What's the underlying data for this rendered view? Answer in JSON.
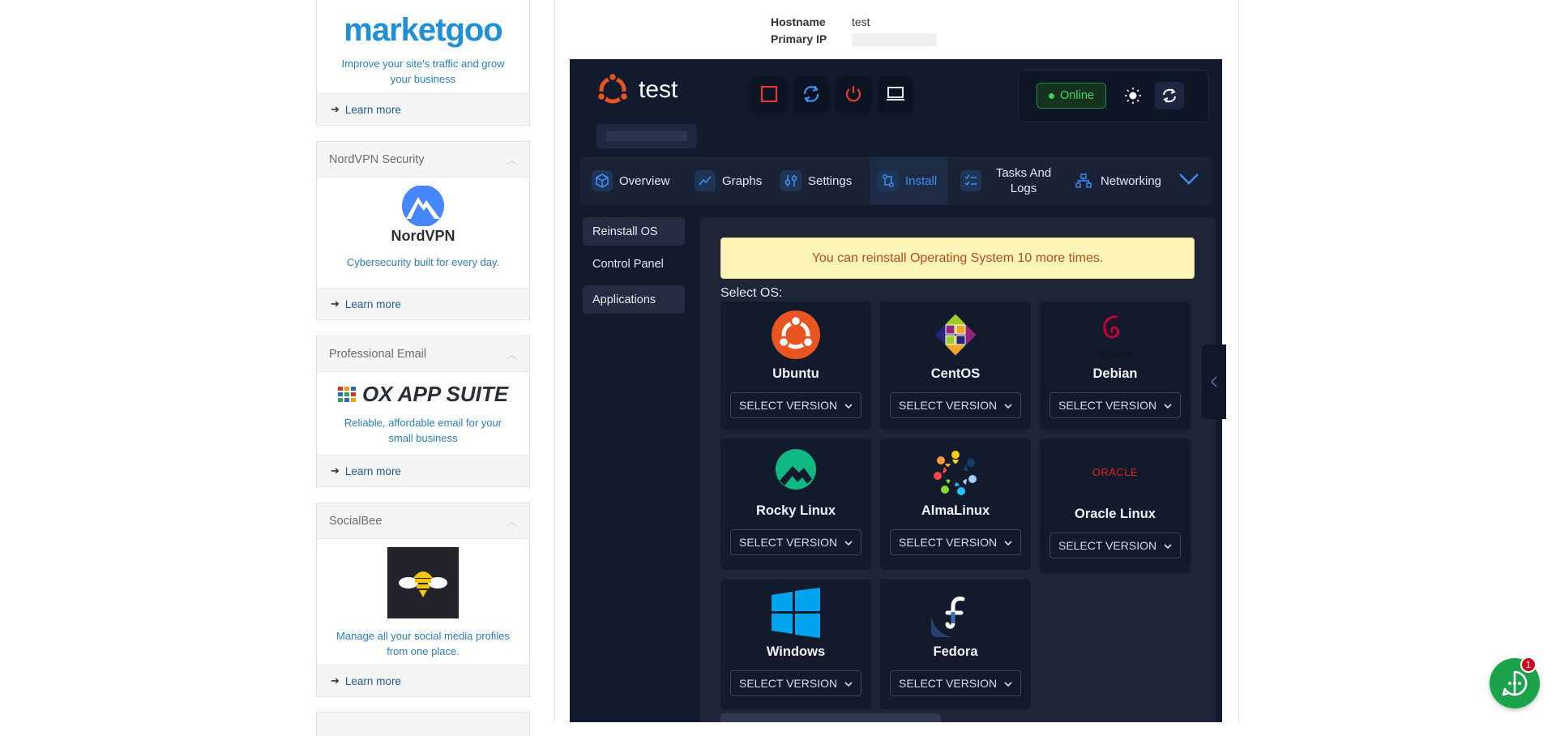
{
  "sidebar": {
    "promos": [
      {
        "title": "",
        "brand": "marketgoo",
        "description": "Improve your site's traffic and grow your business",
        "link": "Learn more"
      },
      {
        "title": "NordVPN Security",
        "brand": "NordVPN",
        "description": "Cybersecurity built for every day.",
        "link": "Learn more"
      },
      {
        "title": "Professional Email",
        "brand": "OX APP SUITE",
        "description": "Reliable, affordable email for your small business",
        "link": "Learn more"
      },
      {
        "title": "SocialBee",
        "brand": "",
        "description": "Manage all your social media profiles from one place.",
        "link": "Learn more"
      }
    ]
  },
  "server_info": {
    "hostname_label": "Hostname",
    "hostname_value": "test",
    "ip_label": "Primary IP"
  },
  "vps": {
    "name": "test",
    "status": "Online",
    "colors": {
      "accent": "#3e8ef7",
      "online": "#46d36a",
      "danger": "#e53935",
      "ubuntu": "#e95420"
    }
  },
  "tabs": [
    {
      "label": "Overview",
      "icon": "cube-icon"
    },
    {
      "label": "Graphs",
      "icon": "chart-line-icon"
    },
    {
      "label": "Settings",
      "icon": "sliders-icon"
    },
    {
      "label": "Install",
      "icon": "install-icon",
      "active": true
    },
    {
      "label": "Tasks And Logs",
      "icon": "tasks-icon"
    },
    {
      "label": "Networking",
      "icon": "network-icon"
    }
  ],
  "subnav": [
    "Reinstall OS",
    "Control Panel",
    "Applications"
  ],
  "install": {
    "alert": "You can reinstall Operating System 10 more times.",
    "select_label": "Select OS:",
    "os_list": [
      {
        "name": "Ubuntu",
        "select": "SELECT VERSION"
      },
      {
        "name": "CentOS",
        "select": "SELECT VERSION"
      },
      {
        "name": "Debian",
        "select": "SELECT VERSION"
      },
      {
        "name": "Rocky Linux",
        "select": "SELECT VERSION"
      },
      {
        "name": "AlmaLinux",
        "select": "SELECT VERSION"
      },
      {
        "name": "Oracle Linux",
        "select": "SELECT VERSION"
      },
      {
        "name": "Windows",
        "select": "SELECT VERSION"
      },
      {
        "name": "Fedora",
        "select": "SELECT VERSION"
      }
    ]
  },
  "chat": {
    "badge": "1"
  }
}
